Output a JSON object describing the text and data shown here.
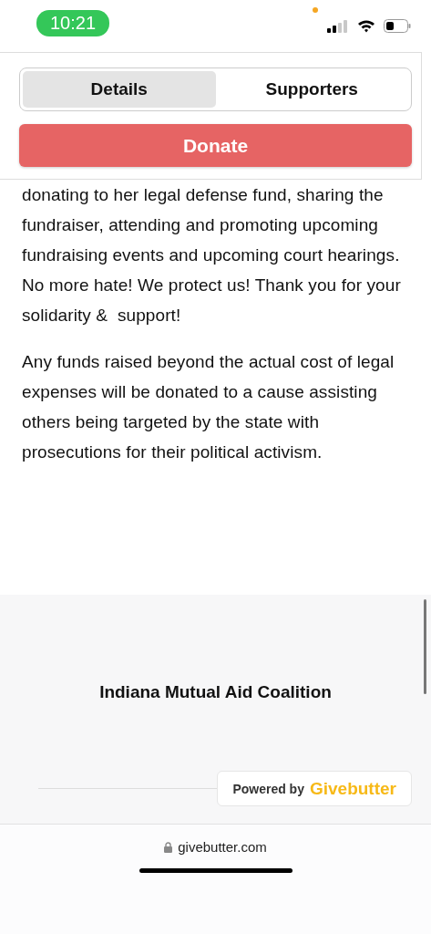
{
  "status_bar": {
    "time": "10:21"
  },
  "tabs": [
    {
      "label": "Details",
      "selected": true
    },
    {
      "label": "Supporters",
      "selected": false
    }
  ],
  "donate_button": "Donate",
  "paragraphs": [
    "donating to her legal defense fund, sharing the fundraiser, attending and promoting upcoming fundraising events and upcoming court hearings. No more hate! We protect us! Thank you for your solidarity &  support!",
    "Any funds raised beyond the actual cost of legal expenses will be donated to a cause assisting others being targeted by the state with prosecutions for their political activism."
  ],
  "footer": {
    "organization": "Indiana Mutual Aid Coalition",
    "powered_by": "Powered by",
    "brand": "Givebutter"
  },
  "browser": {
    "url": "givebutter.com"
  }
}
